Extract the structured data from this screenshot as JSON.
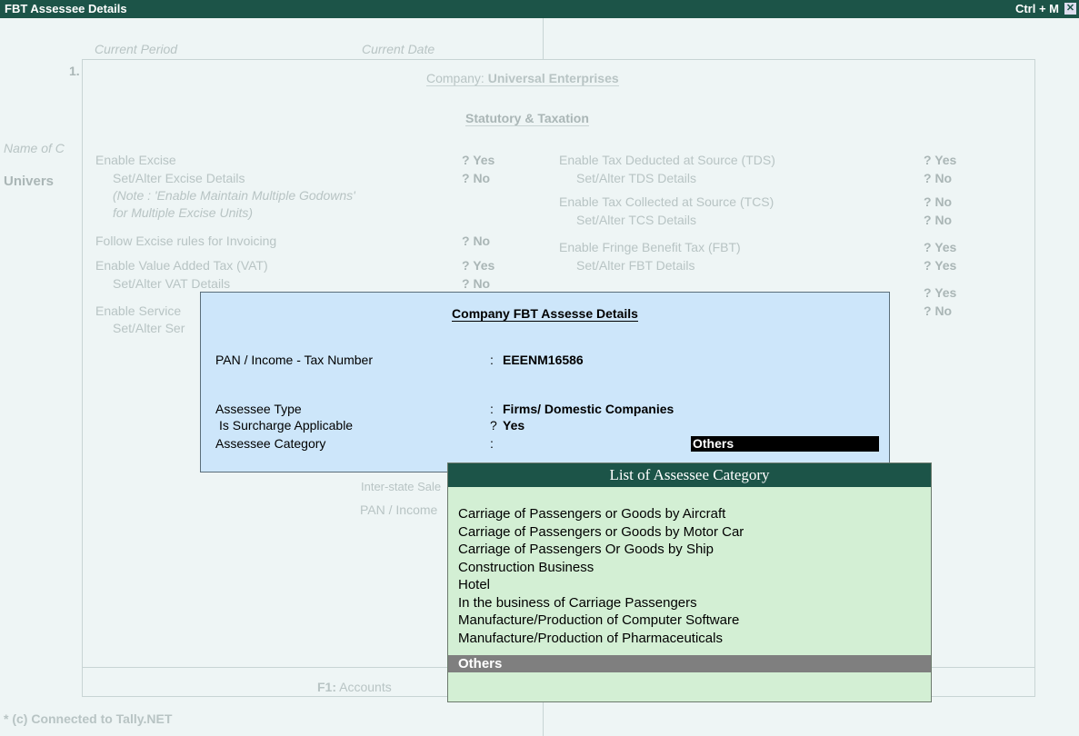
{
  "window": {
    "title": "FBT Assessee Details",
    "shortcut": "Ctrl + M",
    "close_glyph": "✕"
  },
  "background": {
    "current_period": "Current Period",
    "current_date": "Current Date",
    "period_value_fragment": "1.",
    "name_of_fragment": "Name of C",
    "company_fragment": "Univers",
    "company_heading_prefix": "Company:",
    "company_name": "Universal Enterprises",
    "section_title": "Statutory & Taxation",
    "left_rows": [
      {
        "label": "Enable Excise",
        "value": "? Yes",
        "bold": true
      },
      {
        "label": "Set/Alter Excise Details",
        "value": "? No",
        "bold": true
      },
      {
        "label": "(Note : 'Enable Maintain Multiple Godowns'",
        "value": "",
        "bold": false
      },
      {
        "label": "for Multiple Excise Units)",
        "value": "",
        "bold": false
      },
      {
        "label": "Follow Excise rules for Invoicing",
        "value": "? No",
        "bold": true
      },
      {
        "label": "Enable Value Added Tax (VAT)",
        "value": "? Yes",
        "bold": true
      },
      {
        "label": "Set/Alter VAT Details",
        "value": "? No",
        "bold": true
      },
      {
        "label": "Enable Service",
        "value": "",
        "bold": false
      },
      {
        "label": "Set/Alter Ser",
        "value": "",
        "bold": false
      }
    ],
    "right_rows": [
      {
        "label": "Enable Tax Deducted at Source (TDS)",
        "value": "? Yes"
      },
      {
        "label": "Set/Alter TDS Details",
        "value": "? No"
      },
      {
        "label": "Enable Tax Collected at Source (TCS)",
        "value": "? No"
      },
      {
        "label": "Set/Alter TCS Details",
        "value": "? No"
      },
      {
        "label": "Enable Fringe Benefit Tax (FBT)",
        "value": "? Yes"
      },
      {
        "label": "Set/Alter FBT Details",
        "value": "? Yes"
      },
      {
        "label": "",
        "value": "? Yes"
      },
      {
        "label": "",
        "value": "? No"
      }
    ],
    "inter_state": "Inter-state Sale",
    "pan_fragment": "PAN / Income",
    "f1_key": "F1:",
    "f1_label": "Accounts",
    "footer": "* (c) Connected to Tally.NET"
  },
  "modal": {
    "title": "Company FBT Assesse Details",
    "pan_label": "PAN / Income - Tax Number",
    "pan_sep": ":",
    "pan_value": "EEENM16586",
    "assessee_type_label": "Assessee Type",
    "assessee_type_sep": ":",
    "assessee_type_value": "Firms/ Domestic Companies",
    "surcharge_label": "Is Surcharge Applicable",
    "surcharge_sep": "?",
    "surcharge_value": "Yes",
    "category_label": "Assessee Category",
    "category_sep": ":",
    "category_value": "Others"
  },
  "list": {
    "title": "List of Assessee Category",
    "items": [
      "Carriage of Passengers or Goods by Aircraft",
      "Carriage of Passengers or Goods by Motor Car",
      "Carriage of Passengers Or Goods by Ship",
      "Construction Business",
      "Hotel",
      "In the business of Carriage Passengers",
      "Manufacture/Production of Computer Software",
      "Manufacture/Production of Pharmaceuticals"
    ],
    "selected": "Others"
  }
}
